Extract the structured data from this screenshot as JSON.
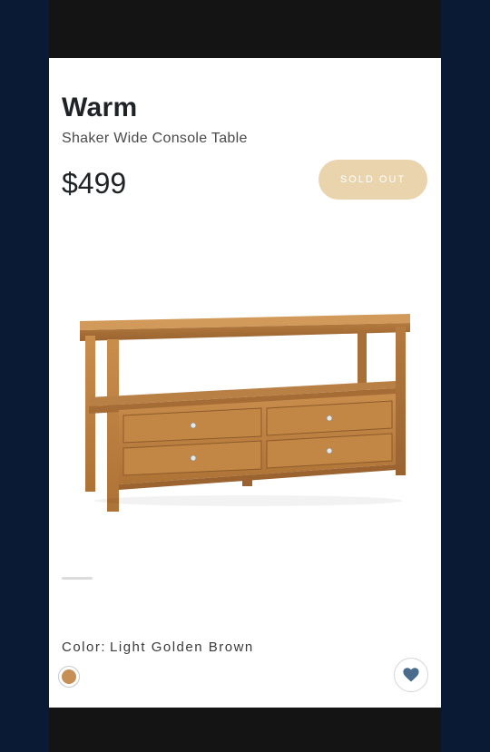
{
  "product": {
    "brand": "Warm",
    "name": "Shaker Wide Console Table",
    "price": "$499",
    "status_label": "SOLD OUT"
  },
  "color": {
    "label": "Color:",
    "value": "Light Golden Brown",
    "swatch_color": "#c68f55"
  },
  "icons": {
    "wishlist": "heart-icon"
  },
  "colors": {
    "sold_out_bg": "#e9d4ae",
    "heart": "#4a6b8c"
  }
}
